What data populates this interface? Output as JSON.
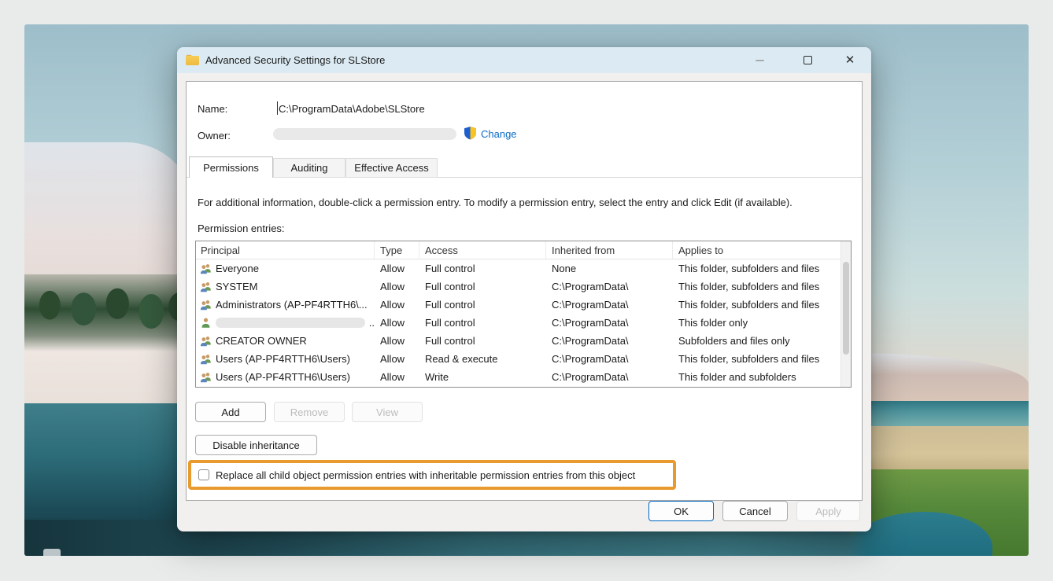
{
  "window": {
    "title": "Advanced Security Settings for SLStore",
    "icons": {
      "titlebar_icon": "folder-icon",
      "minimize": "minimize-icon",
      "maximize": "maximize-icon",
      "close": "close-icon"
    }
  },
  "fields": {
    "name_label": "Name:",
    "name_value": "C:\\ProgramData\\Adobe\\SLStore",
    "owner_label": "Owner:",
    "owner_value_display": "redacted-pill",
    "change_link": "Change",
    "shield_icon": "uac-shield-icon"
  },
  "tabs": [
    {
      "label": "Permissions",
      "active": true
    },
    {
      "label": "Auditing",
      "active": false
    },
    {
      "label": "Effective Access",
      "active": false
    }
  ],
  "description": "For additional information, double-click a permission entry. To modify a permission entry, select the entry and click Edit (if available).",
  "entries_label": "Permission entries:",
  "table": {
    "columns": [
      "Principal",
      "Type",
      "Access",
      "Inherited from",
      "Applies to"
    ],
    "rows": [
      {
        "icon": "group",
        "principal": "Everyone",
        "type": "Allow",
        "access": "Full control",
        "inherited_from": "None",
        "applies_to": "This folder, subfolders and files"
      },
      {
        "icon": "group",
        "principal": "SYSTEM",
        "type": "Allow",
        "access": "Full control",
        "inherited_from": "C:\\ProgramData\\",
        "applies_to": "This folder, subfolders and files"
      },
      {
        "icon": "group",
        "principal": "Administrators (AP-PF4RTTH6\\...",
        "type": "Allow",
        "access": "Full control",
        "inherited_from": "C:\\ProgramData\\",
        "applies_to": "This folder, subfolders and files"
      },
      {
        "icon": "user",
        "principal": "",
        "redacted": true,
        "principal_suffix": "..",
        "type": "Allow",
        "access": "Full control",
        "inherited_from": "C:\\ProgramData\\",
        "applies_to": "This folder only"
      },
      {
        "icon": "group",
        "principal": "CREATOR OWNER",
        "type": "Allow",
        "access": "Full control",
        "inherited_from": "C:\\ProgramData\\",
        "applies_to": "Subfolders and files only"
      },
      {
        "icon": "group",
        "principal": "Users (AP-PF4RTTH6\\Users)",
        "type": "Allow",
        "access": "Read & execute",
        "inherited_from": "C:\\ProgramData\\",
        "applies_to": "This folder, subfolders and files"
      },
      {
        "icon": "group",
        "principal": "Users (AP-PF4RTTH6\\Users)",
        "type": "Allow",
        "access": "Write",
        "inherited_from": "C:\\ProgramData\\",
        "applies_to": "This folder and subfolders"
      }
    ]
  },
  "buttons": {
    "add": "Add",
    "remove": "Remove",
    "view": "View",
    "disable_inheritance": "Disable inheritance",
    "ok": "OK",
    "cancel": "Cancel",
    "apply": "Apply"
  },
  "buttons_state": {
    "remove_disabled": true,
    "view_disabled": true,
    "apply_disabled": true
  },
  "checkbox": {
    "label": "Replace all child object permission entries with inheritable permission entries from this object",
    "checked": false
  },
  "colors": {
    "highlight_orange": "#E89A2E",
    "link_blue": "#0A6CC4",
    "titlebar_blue": "#DCEBF3",
    "ok_border_blue": "#0067C0"
  }
}
